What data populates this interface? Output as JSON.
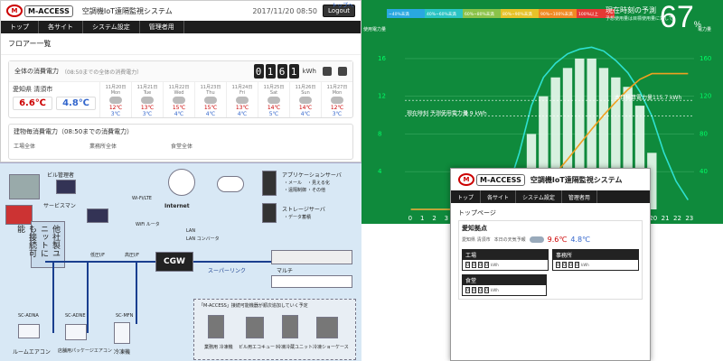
{
  "panel_floor": {
    "logo": {
      "mark": "M",
      "text": "M-ACCESS"
    },
    "system_title": "空調機IoT遠隔監視システム",
    "datetime": "2017/11/20 08:50",
    "top_link": "トップへ",
    "logout": "Logout",
    "nav": [
      "トップ",
      "各サイト",
      "システム設定",
      "管理者用"
    ],
    "page_title": "フロアー一覧",
    "total_label": "全体の消費電力",
    "total_note": "（08:50までの全体の消費電力）",
    "total_digits": [
      "0",
      "1",
      "6",
      "1"
    ],
    "total_unit": "kWh",
    "place": "愛知県 清須市",
    "temp_high": "6.6℃",
    "temp_low": "4.8℃",
    "days": [
      {
        "date": "11月20日",
        "dow": "Mon",
        "hi": "12℃",
        "lo": "3℃"
      },
      {
        "date": "11月21日",
        "dow": "Tue",
        "hi": "13℃",
        "lo": "3℃"
      },
      {
        "date": "11月22日",
        "dow": "Wed",
        "hi": "15℃",
        "lo": "4℃"
      },
      {
        "date": "11月23日",
        "dow": "Thu",
        "hi": "15℃",
        "lo": "4℃"
      },
      {
        "date": "11月24日",
        "dow": "Fri",
        "hi": "13℃",
        "lo": "4℃"
      },
      {
        "date": "11月25日",
        "dow": "Sat",
        "hi": "14℃",
        "lo": "5℃"
      },
      {
        "date": "11月26日",
        "dow": "Sun",
        "hi": "14℃",
        "lo": "4℃"
      },
      {
        "date": "11月27日",
        "dow": "Mon",
        "hi": "12℃",
        "lo": "3℃"
      }
    ],
    "building_label": "建物毎消費電力（08:50までの消費電力）",
    "buildings": [
      "工場全体",
      "業務所全体",
      "食堂全体"
    ]
  },
  "panel_chart": {
    "legend": [
      "~40%未満",
      "40%~60%未満",
      "60%~80%未満",
      "80%~90%未満",
      "90%~100%未満",
      "100%以上"
    ],
    "legend_colors": [
      "#29a8e0",
      "#2bc4c4",
      "#8bc34a",
      "#e6c229",
      "#f08a24",
      "#e53935"
    ],
    "forecast_label": "現在時刻の予測",
    "forecast_sub": "予想使用量は目標使用量に対して",
    "forecast_value": "67",
    "forecast_unit": "%",
    "left_axis_title": "使用電力量",
    "right_axis_title": "電力量",
    "cum_label": "本日積算電力量",
    "cum_value": "115.7 kWh",
    "forecast_line_label": "現在時刻 予測使用電力量",
    "forecast_line_value": "9.9 kWh",
    "chart_data": {
      "type": "bar",
      "x": [
        0,
        1,
        2,
        3,
        4,
        5,
        6,
        7,
        8,
        9,
        10,
        11,
        12,
        13,
        14,
        15,
        16,
        17,
        18,
        19,
        20,
        21,
        22,
        23
      ],
      "categories": [
        "0",
        "1",
        "2",
        "3",
        "4",
        "5",
        "6",
        "7",
        "8",
        "9",
        "10",
        "11",
        "12",
        "13",
        "14",
        "15",
        "16",
        "17",
        "18",
        "19",
        "20",
        "21",
        "22",
        "23"
      ],
      "values": [
        0,
        0,
        0,
        0,
        0,
        0,
        0,
        0,
        1,
        3,
        8,
        12,
        14,
        15,
        16,
        16,
        15,
        14,
        13,
        11,
        6,
        0,
        0,
        0
      ],
      "left_ticks": [
        "16",
        "12",
        "8",
        "4"
      ],
      "right_ticks": [
        "160",
        "120",
        "80",
        "40"
      ],
      "ylim": [
        0,
        18
      ],
      "cumulative": [
        0,
        0,
        0,
        0,
        0,
        0,
        0,
        0,
        1,
        4,
        12,
        24,
        38,
        53,
        69,
        85,
        100,
        114,
        127,
        138,
        144,
        144,
        144,
        144
      ],
      "forecast_curve": [
        0,
        0,
        0,
        0,
        0,
        0,
        0,
        0,
        2,
        6,
        11,
        14,
        15.5,
        16.5,
        17,
        17.2,
        16.8,
        15.8,
        14.5,
        12.5,
        9.9,
        6,
        3,
        1
      ],
      "x_tick_labels": [
        "0",
        "1",
        "2",
        "3",
        "4",
        "5",
        "6",
        "7",
        "8",
        "9",
        "10",
        "11",
        "12",
        "13",
        "14",
        "15",
        "16",
        "17",
        "18",
        "19",
        "20",
        "21",
        "22",
        "23"
      ]
    }
  },
  "panel_diagram": {
    "building": "ビル管理者",
    "service": "サービスマン",
    "internet": "Internet",
    "app_server": "アプリケーションサーバ",
    "app_items": [
      "・メール",
      "・見える化",
      "・遠隔制御",
      "・その他"
    ],
    "storage": "ストレージサーバ",
    "storage_items": [
      "・データ蓄積"
    ],
    "wifi": "Wi-Fi/LTE",
    "wifi_router": "WiFi ルータ",
    "lan": "LAN",
    "lan_conv": "LAN コンバータ",
    "cgw": "CGW",
    "other": "他社製ユニットにも接続可能",
    "rom_if": "低圧I/F",
    "rom_if2": "高圧I/F",
    "super_link": "スーパーリンク",
    "multi": "マルチ",
    "models": [
      "SC-ADNA",
      "SC-ADNE",
      "SC-MFN"
    ],
    "unit_labels": [
      "ルームエアコン",
      "店舗用パッケージエアコン",
      "冷凍機"
    ],
    "plan_note": "「M-ACCESS」接続可能機器が順次追加していく予定",
    "planned": [
      "業務用\n冷凍機",
      "ビル用エコキュート",
      "冷凍冷蔵ユニット",
      "冷凍ショーケース"
    ]
  },
  "panel_top": {
    "logo": {
      "mark": "M",
      "text": "M-ACCESS"
    },
    "system_title": "空調機IoT遠隔監視システム",
    "nav": [
      "トップ",
      "各サイト",
      "システム設定",
      "管理者用"
    ],
    "page_title": "トップページ",
    "place_heading": "愛知拠点",
    "place": "愛知県 清須市",
    "weather_label": "本日の天気予報",
    "temp_high": "9.6℃",
    "temp_low": "4.8℃",
    "blocks": [
      {
        "name": "工場",
        "digits": [
          "0",
          "0",
          "0",
          "0"
        ],
        "unit": "kWh"
      },
      {
        "name": "事務所",
        "digits": [
          "0",
          "0",
          "0",
          "0"
        ],
        "unit": "kWh"
      },
      {
        "name": "食堂",
        "digits": [
          "0",
          "0",
          "0",
          "0"
        ],
        "unit": "kWh"
      }
    ]
  }
}
